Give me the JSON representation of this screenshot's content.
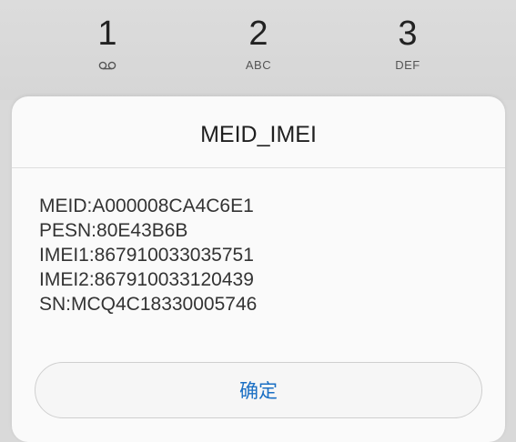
{
  "dialpad": {
    "keys": [
      {
        "digit": "1",
        "sub": "voicemail-icon"
      },
      {
        "digit": "2",
        "sub": "ABC"
      },
      {
        "digit": "3",
        "sub": "DEF"
      }
    ]
  },
  "dialog": {
    "title": "MEID_IMEI",
    "lines": [
      "MEID:A000008CA4C6E1",
      "PESN:80E43B6B",
      "IMEI1:867910033035751",
      "IMEI2:867910033120439",
      "SN:MCQ4C18330005746"
    ],
    "confirm_label": "确定"
  },
  "colors": {
    "accent": "#1a6fc4",
    "background": "#d9d9d9",
    "dialog_bg": "#fafafa"
  }
}
